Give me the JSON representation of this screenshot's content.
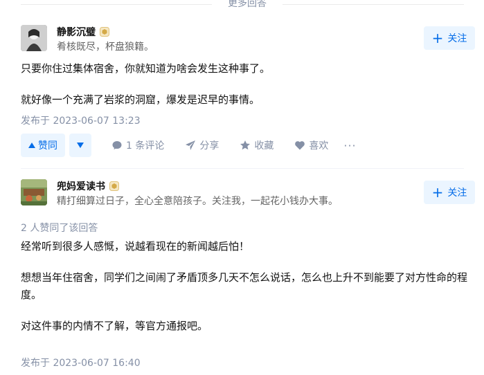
{
  "more_answers": {
    "label": "更多回答"
  },
  "answers": [
    {
      "author": {
        "name": "静影沉璧",
        "headline": "肴核既尽，杯盘狼籍。"
      },
      "follow_label": "关注",
      "paragraphs": [
        "只要你住过集体宿舍，你就知道为啥会发生这种事了。",
        "就好像一个充满了岩浆的洞窟，爆发是迟早的事情。"
      ],
      "time": "发布于 2023-06-07 13:23",
      "actions": {
        "upvote": "赞同",
        "comments": "1 条评论",
        "share": "分享",
        "collect": "收藏",
        "like": "喜欢",
        "more": "···"
      }
    },
    {
      "author": {
        "name": "兜妈爱读书",
        "headline": "精打细算过日子，全心全意陪孩子。关注我，一起花小钱办大事。"
      },
      "follow_label": "关注",
      "voters": "2 人赞同了该回答",
      "paragraphs": [
        "经常听到很多人感慨，说越看现在的新闻越后怕！",
        "想想当年住宿舍，同学们之间闹了矛盾顶多几天不怎么说话，怎么也上升不到能要了对方性命的程度。",
        "对这件事的内情不了解，等官方通报吧。"
      ],
      "time": "发布于 2023-06-07 16:40"
    }
  ],
  "colors": {
    "accent": "#056de8",
    "accent_bg": "#ebf5ff",
    "muted": "#8590a6",
    "text": "#121212"
  }
}
